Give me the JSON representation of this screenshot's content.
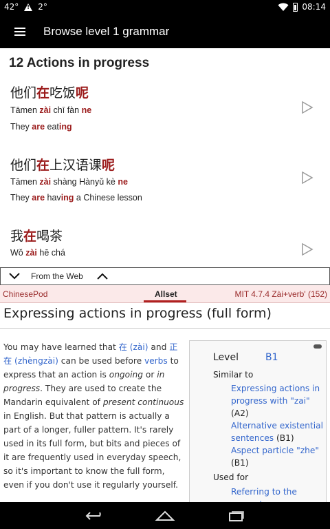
{
  "status_bar": {
    "temp": "42°",
    "temp2": "2°",
    "time": "08:14"
  },
  "app_bar": {
    "title": "Browse level 1 grammar"
  },
  "section": {
    "title": "12 Actions in progress"
  },
  "entries": [
    {
      "hanzi": [
        [
          "他们",
          false
        ],
        [
          "在",
          true
        ],
        [
          "吃饭",
          false
        ],
        [
          "呢",
          true
        ]
      ],
      "pinyin": [
        [
          "Tāmen ",
          false
        ],
        [
          "zài",
          true
        ],
        [
          " chī fàn ",
          false
        ],
        [
          "ne",
          true
        ]
      ],
      "english": [
        [
          "They ",
          false
        ],
        [
          "are",
          true
        ],
        [
          " eat",
          false
        ],
        [
          "ing",
          true
        ]
      ]
    },
    {
      "hanzi": [
        [
          "他们",
          false
        ],
        [
          "在",
          true
        ],
        [
          "上汉语课",
          false
        ],
        [
          "呢",
          true
        ]
      ],
      "pinyin": [
        [
          "Tāmen ",
          false
        ],
        [
          "zài",
          true
        ],
        [
          " shàng Hànyǔ kè ",
          false
        ],
        [
          "ne",
          true
        ]
      ],
      "english": [
        [
          "They ",
          false
        ],
        [
          "are",
          true
        ],
        [
          " hav",
          false
        ],
        [
          "ing",
          true
        ],
        [
          " a Chinese lesson",
          false
        ]
      ]
    },
    {
      "hanzi": [
        [
          "我",
          false
        ],
        [
          "在",
          true
        ],
        [
          "喝茶",
          false
        ]
      ],
      "pinyin": [
        [
          "Wǒ ",
          false
        ],
        [
          "zài",
          true
        ],
        [
          " hē chá",
          false
        ]
      ],
      "english": []
    }
  ],
  "web_bar": {
    "label": "From the Web"
  },
  "web_tabs": {
    "left": "ChinesePod",
    "active": "Allset",
    "right": "MIT 4.7.4 Zài+verb' (152)"
  },
  "article": {
    "title": "Expressing actions in progress (full form)",
    "body": [
      [
        "You may have learned that ",
        "t"
      ],
      [
        "在 (zài)",
        "a"
      ],
      [
        " and ",
        "t"
      ],
      [
        "正在 (zhèngzài)",
        "a"
      ],
      [
        " can be used before ",
        "t"
      ],
      [
        "verbs",
        "a"
      ],
      [
        " to express that an action is ",
        "t"
      ],
      [
        "ongoing",
        "i"
      ],
      [
        " or ",
        "t"
      ],
      [
        "in progress",
        "i"
      ],
      [
        ". They are used to create the Mandarin equivalent of ",
        "t"
      ],
      [
        "present continuous",
        "i"
      ],
      [
        " in English. But that pattern is actually a part of a longer, fuller pattern. It's rarely used in its full form, but bits and pieces of it are frequently used in everyday speech, so it's important to know the full form, even if you don't use it regularly yourself.",
        "t"
      ]
    ]
  },
  "infobox": {
    "level_label": "Level",
    "level_value": "B1",
    "similar_label": "Similar to",
    "similar_items": [
      {
        "link": "Expressing actions in progress with \"zai\"",
        "suffix": " (A2)"
      },
      {
        "link": "Alternative existential sentences",
        "suffix": " (B1)"
      },
      {
        "link": "Aspect particle \"zhe\"",
        "suffix": " (B1)"
      }
    ],
    "used_for_label": "Used for",
    "used_for_items": [
      "Referring to the present"
    ]
  },
  "colors": {
    "highlight": "#9b1b1b",
    "link": "#3366cc",
    "tab_bg": "#fbe9e9",
    "tab_accent": "#b02020"
  }
}
